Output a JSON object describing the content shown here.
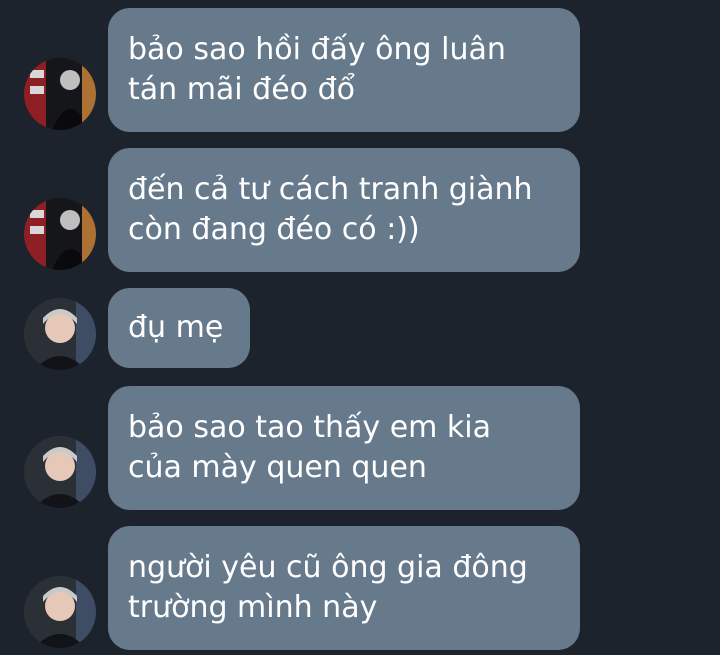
{
  "colors": {
    "background": "#1c232c",
    "bubble": "#677a8c",
    "text": "#ffffff"
  },
  "messages": [
    {
      "sender": "contact-a",
      "avatar_icon": "contact-a-avatar-icon",
      "lines": [
        "bảo sao hồi đấy ông luân",
        "tán mãi đéo đổ"
      ]
    },
    {
      "sender": "contact-a",
      "avatar_icon": "contact-a-avatar-icon",
      "lines": [
        "đến cả tư cách tranh giành",
        "còn đang đéo có :))"
      ]
    },
    {
      "sender": "contact-b",
      "avatar_icon": "contact-b-avatar-icon",
      "lines": [
        "đụ mẹ"
      ]
    },
    {
      "sender": "contact-b",
      "avatar_icon": "contact-b-avatar-icon",
      "lines": [
        "bảo sao tao thấy em kia",
        "của mày quen quen"
      ]
    },
    {
      "sender": "contact-b",
      "avatar_icon": "contact-b-avatar-icon",
      "lines": [
        "người yêu cũ ông gia đông",
        "trường mình này"
      ]
    }
  ]
}
